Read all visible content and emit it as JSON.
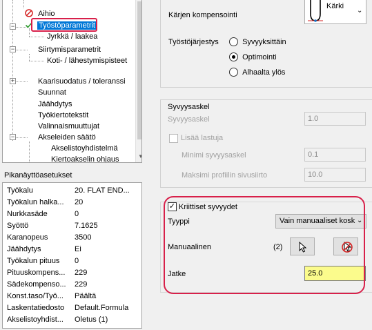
{
  "tree": {
    "items": [
      {
        "label": "Aihio"
      },
      {
        "label": "Työstöparametrit"
      },
      {
        "label": "Jyrkkä / laakea"
      },
      {
        "label": "Siirtymisparametrit"
      },
      {
        "label": "Koti- / lähestymispisteet"
      },
      {
        "label": "Kaarisuodatus / toleranssi"
      },
      {
        "label": "Suunnat"
      },
      {
        "label": "Jäähdytys"
      },
      {
        "label": "Työkiertotekstit"
      },
      {
        "label": "Valinnaismuuttujat"
      },
      {
        "label": "Akseleiden säätö"
      },
      {
        "label": "Akselistoyhdistelmä"
      },
      {
        "label": "Kiertoakselin ohjaus"
      }
    ]
  },
  "quick_settings": {
    "title": "Pikanäyttöasetukset",
    "rows": [
      {
        "key": "Työkalu",
        "value": "20. FLAT END..."
      },
      {
        "key": "Työkalun halka...",
        "value": "20"
      },
      {
        "key": "Nurkkasäde",
        "value": "0"
      },
      {
        "key": "Syöttö",
        "value": "7.1625"
      },
      {
        "key": "Karanopeus",
        "value": "3500"
      },
      {
        "key": "Jäähdytys",
        "value": "Ei"
      },
      {
        "key": "Työkalun pituus",
        "value": "0"
      },
      {
        "key": "Pituuskompens...",
        "value": "229"
      },
      {
        "key": "Sädekompenso...",
        "value": "229"
      },
      {
        "key": "Konst.taso/Työ...",
        "value": "Päältä"
      },
      {
        "key": "Laskentatiedosto",
        "value": "Default.Formula"
      },
      {
        "key": "Akselistoyhdist...",
        "value": "Oletus (1)"
      }
    ]
  },
  "compensation": {
    "label": "Kärjen kompensointi",
    "value": "Kärki"
  },
  "machining_order": {
    "label": "Työstöjärjestys",
    "options": [
      "Syvyyksittäin",
      "Optimointi",
      "Alhaalta ylös"
    ]
  },
  "depth_step": {
    "title": "Syvyysaskel",
    "depth_label": "Syvyysaskel",
    "depth_value": "1.0",
    "add_cuts_label": "Lisää lastuja",
    "min_label": "Minimi syvyysaskel",
    "min_value": "0.1",
    "max_label": "Maksimi profiilin sivusiirto",
    "max_value": "10.0"
  },
  "critical_depths": {
    "label": "Kriittiset syvyydet",
    "type_label": "Tyyppi",
    "type_value": "Vain manuaaliset kosk",
    "manual_label": "Manuaalinen",
    "manual_count": "(2)",
    "extend_label": "Jatke",
    "extend_value": "25.0"
  }
}
